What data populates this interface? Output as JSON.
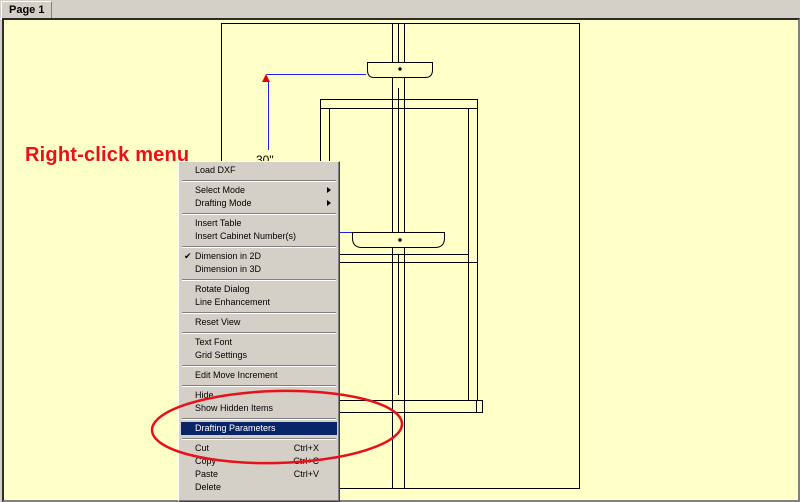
{
  "tabs": [
    {
      "label": "Page 1"
    }
  ],
  "annotation": {
    "text": "Right-click menu",
    "color": "#e8101a"
  },
  "dimension": {
    "label": "30\""
  },
  "menu": {
    "load_dxf": "Load DXF",
    "select_mode": "Select Mode",
    "drafting_mode": "Drafting Mode",
    "insert_table": "Insert Table",
    "insert_cabinet_numbers": "Insert Cabinet Number(s)",
    "dimension_2d": "Dimension in 2D",
    "dimension_3d": "Dimension in 3D",
    "rotate_dialog": "Rotate Dialog",
    "line_enhancement": "Line Enhancement",
    "reset_view": "Reset View",
    "text_font": "Text Font",
    "grid_settings": "Grid Settings",
    "edit_move_increment": "Edit Move Increment",
    "hide": "Hide",
    "show_hidden_items": "Show Hidden Items",
    "drafting_parameters": "Drafting Parameters",
    "cut": "Cut",
    "cut_shortcut": "Ctrl+X",
    "copy": "Copy",
    "copy_shortcut": "Ctrl+C",
    "paste": "Paste",
    "paste_shortcut": "Ctrl+V",
    "delete": "Delete",
    "checked_item": "dimension_2d",
    "selected_item": "drafting_parameters"
  },
  "icons": {
    "check": "check-icon",
    "submenu": "submenu-arrow-icon"
  },
  "colors": {
    "canvas_bg": "#ffffc8",
    "menu_highlight": "#0a246a",
    "annotation": "#e8101a",
    "dimension_line": "#2020e0"
  }
}
